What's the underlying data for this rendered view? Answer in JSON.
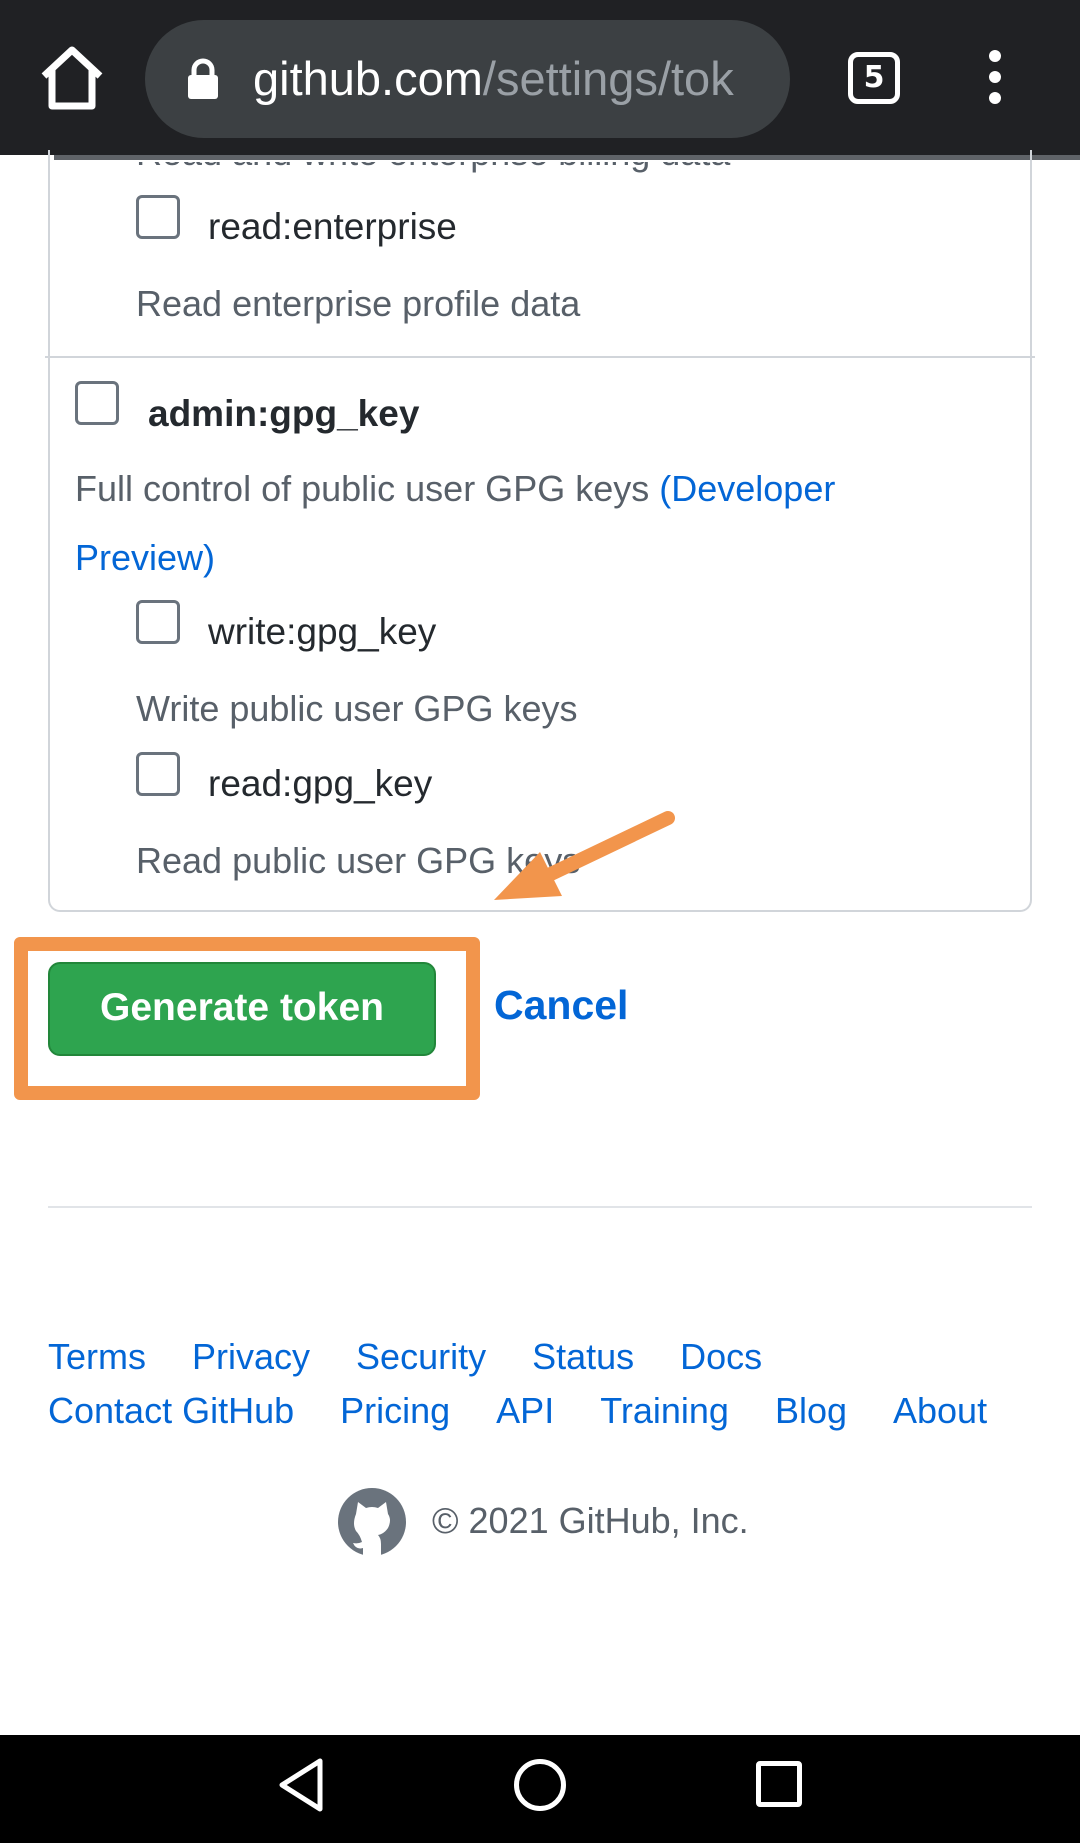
{
  "browser": {
    "url_host": "github.com",
    "url_path": "/settings/tok",
    "tab_count": "5",
    "load_progress": 0.05
  },
  "scopes": {
    "cut_off_description": "Read and write enterprise billing data",
    "read_enterprise": {
      "label": "read:enterprise",
      "description": "Read enterprise profile data"
    },
    "admin_gpg_key": {
      "label": "admin:gpg_key",
      "description": "Full control of public user GPG keys",
      "description_link_line1": "(Developer",
      "description_link_line2": "Preview)"
    },
    "write_gpg_key": {
      "label": "write:gpg_key",
      "description": "Write public user GPG keys"
    },
    "read_gpg_key": {
      "label": "read:gpg_key",
      "description": "Read public user GPG keys"
    }
  },
  "actions": {
    "generate_label": "Generate token",
    "cancel_label": "Cancel"
  },
  "annotation": {
    "highlight_color": "#f2954c"
  },
  "footer": {
    "row1": [
      "Terms",
      "Privacy",
      "Security",
      "Status",
      "Docs"
    ],
    "row2": [
      "Contact GitHub",
      "Pricing",
      "API",
      "Training",
      "Blog",
      "About"
    ],
    "copyright": "© 2021 GitHub, Inc."
  }
}
